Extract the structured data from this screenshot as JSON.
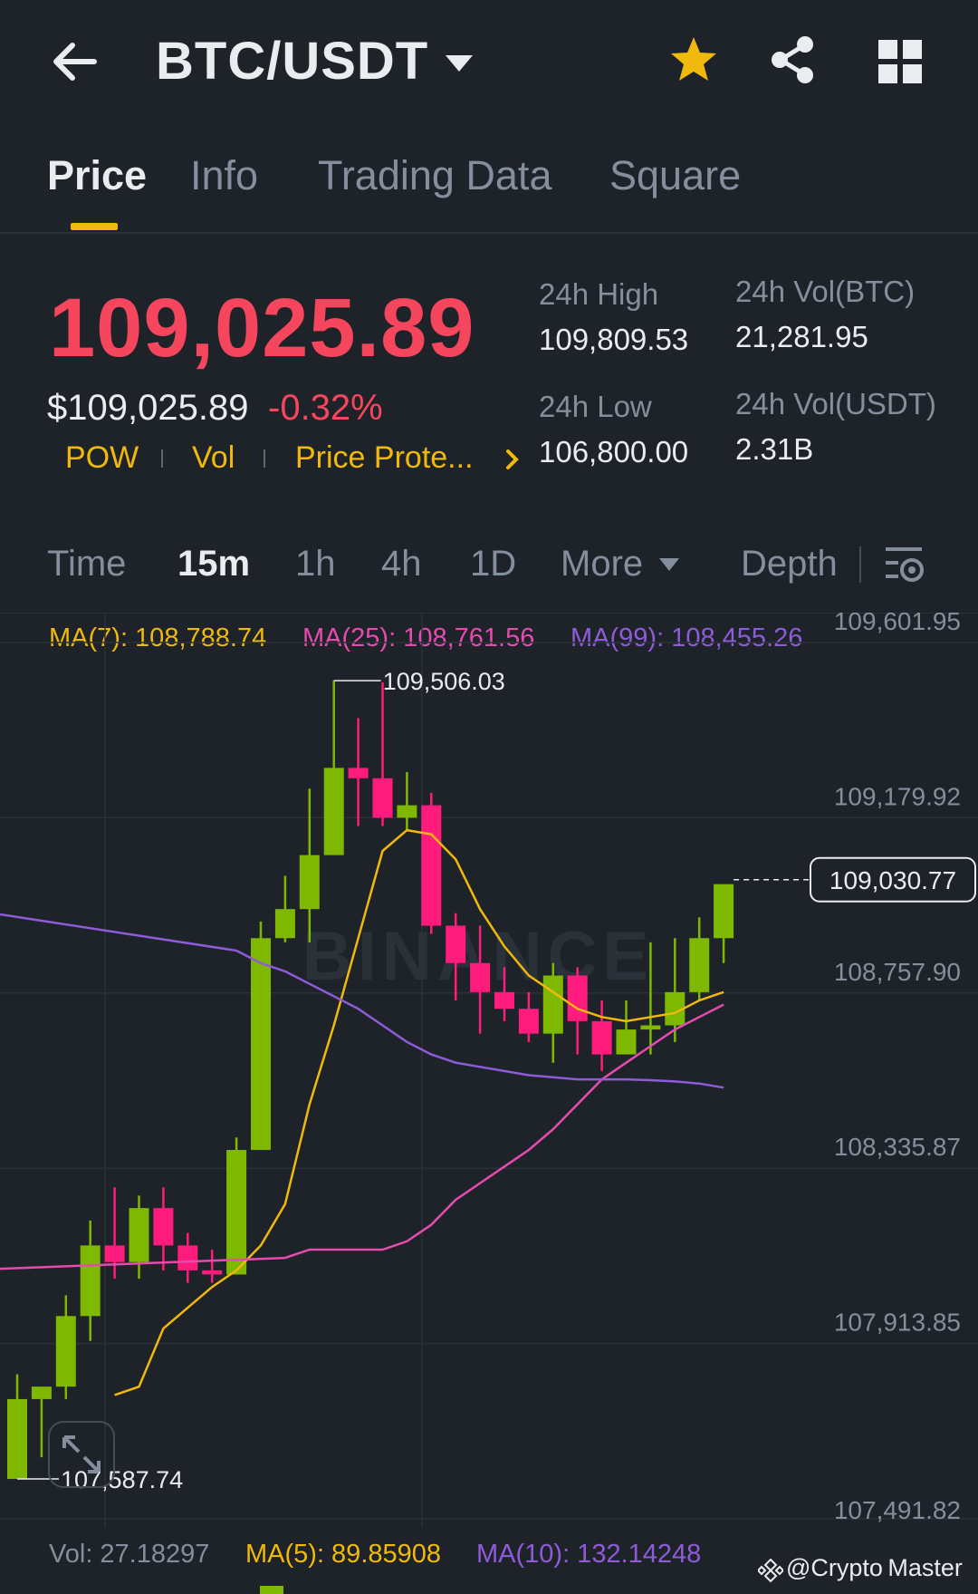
{
  "header": {
    "pair": "BTC/USDT",
    "icons": [
      "back-arrow-icon",
      "caret-down-icon",
      "star-icon",
      "share-icon",
      "grid-icon"
    ],
    "favorite_color": "#f0b90b"
  },
  "tabs": [
    {
      "label": "Price",
      "active": true
    },
    {
      "label": "Info",
      "active": false
    },
    {
      "label": "Trading Data",
      "active": false
    },
    {
      "label": "Square",
      "active": false
    }
  ],
  "ticker": {
    "last_price": "109,025.89",
    "usd_price": "$109,025.89",
    "change_pct": "-0.32%",
    "tags": [
      "POW",
      "Vol",
      "Price Prote..."
    ],
    "high_label": "24h High",
    "high_value": "109,809.53",
    "low_label": "24h Low",
    "low_value": "106,800.00",
    "vol_btc_label": "24h Vol(BTC)",
    "vol_btc_value": "21,281.95",
    "vol_usdt_label": "24h Vol(USDT)",
    "vol_usdt_value": "2.31B"
  },
  "intervals": {
    "items": [
      {
        "label": "Time",
        "active": false
      },
      {
        "label": "15m",
        "active": true
      },
      {
        "label": "1h",
        "active": false
      },
      {
        "label": "4h",
        "active": false
      },
      {
        "label": "1D",
        "active": false
      },
      {
        "label": "More",
        "active": false
      },
      {
        "label": "Depth",
        "active": false
      }
    ]
  },
  "ma_legend": {
    "ma7": "MA(7): 108,788.74",
    "ma25": "MA(25): 108,761.56",
    "ma99": "MA(99): 108,455.26"
  },
  "colors": {
    "up": "#7fb800",
    "down": "#ff1c7c",
    "ma7": "#f0b90b",
    "ma25": "#e64bb0",
    "ma99": "#8e5bd9",
    "bg": "#1e2329",
    "accent": "#f0b90b"
  },
  "chart_data": {
    "type": "candlestick",
    "interval": "15m",
    "y_ticks": [
      "109,601.95",
      "109,179.92",
      "108,757.90",
      "108,335.87",
      "107,913.85",
      "107,491.82"
    ],
    "y_tick_values": [
      109601.95,
      109179.92,
      108757.9,
      108335.87,
      107913.85,
      107491.82
    ],
    "ylim": [
      107491.82,
      109601.95
    ],
    "high_marker": "109,506.03",
    "low_marker": "107,587.74",
    "current_price_label": "109,030.77",
    "current_price": 109030.77,
    "candles": [
      {
        "o": 107587.74,
        "h": 107840,
        "l": 107587.74,
        "c": 107780
      },
      {
        "o": 107780,
        "h": 107780,
        "l": 107640,
        "c": 107810
      },
      {
        "o": 107810,
        "h": 108030,
        "l": 107780,
        "c": 107980
      },
      {
        "o": 107980,
        "h": 108210,
        "l": 107920,
        "c": 108150
      },
      {
        "o": 108150,
        "h": 108290,
        "l": 108070,
        "c": 108110
      },
      {
        "o": 108110,
        "h": 108270,
        "l": 108070,
        "c": 108240
      },
      {
        "o": 108240,
        "h": 108290,
        "l": 108090,
        "c": 108150
      },
      {
        "o": 108150,
        "h": 108180,
        "l": 108060,
        "c": 108090
      },
      {
        "o": 108090,
        "h": 108140,
        "l": 108060,
        "c": 108080
      },
      {
        "o": 108080,
        "h": 108410,
        "l": 108080,
        "c": 108380
      },
      {
        "o": 108380,
        "h": 108930,
        "l": 108380,
        "c": 108890
      },
      {
        "o": 108890,
        "h": 109040,
        "l": 108880,
        "c": 108960
      },
      {
        "o": 108960,
        "h": 109250,
        "l": 108880,
        "c": 109090
      },
      {
        "o": 109090,
        "h": 109510,
        "l": 109090,
        "c": 109300
      },
      {
        "o": 109300,
        "h": 109420,
        "l": 109160,
        "c": 109275
      },
      {
        "o": 109275,
        "h": 109506.03,
        "l": 109160,
        "c": 109180
      },
      {
        "o": 109180,
        "h": 109290,
        "l": 109150,
        "c": 109210
      },
      {
        "o": 109210,
        "h": 109240,
        "l": 108900,
        "c": 108920
      },
      {
        "o": 108920,
        "h": 108950,
        "l": 108740,
        "c": 108830
      },
      {
        "o": 108830,
        "h": 108920,
        "l": 108660,
        "c": 108760
      },
      {
        "o": 108760,
        "h": 108820,
        "l": 108690,
        "c": 108720
      },
      {
        "o": 108720,
        "h": 108760,
        "l": 108640,
        "c": 108660
      },
      {
        "o": 108660,
        "h": 108830,
        "l": 108590,
        "c": 108800
      },
      {
        "o": 108800,
        "h": 108820,
        "l": 108610,
        "c": 108690
      },
      {
        "o": 108690,
        "h": 108740,
        "l": 108570,
        "c": 108610
      },
      {
        "o": 108610,
        "h": 108740,
        "l": 108610,
        "c": 108670
      },
      {
        "o": 108670,
        "h": 108880,
        "l": 108610,
        "c": 108680
      },
      {
        "o": 108680,
        "h": 108890,
        "l": 108640,
        "c": 108760
      },
      {
        "o": 108760,
        "h": 108940,
        "l": 108740,
        "c": 108890
      },
      {
        "o": 108890,
        "h": 109020,
        "l": 108830,
        "c": 109020
      }
    ],
    "ma7": [
      107790,
      107810,
      107950,
      108000,
      108050,
      108090,
      108150,
      108250,
      108490,
      108680,
      108890,
      109100,
      109150,
      109140,
      109080,
      108960,
      108870,
      108800,
      108760,
      108720,
      108700,
      108690,
      108700,
      108710,
      108740,
      108760
    ],
    "ma25": [
      108120,
      108140,
      108140,
      108140,
      108140,
      108160,
      108200,
      108260,
      108300,
      108340,
      108380,
      108430,
      108490,
      108550,
      108590,
      108630,
      108670,
      108700,
      108730
    ],
    "ma99": [
      108860,
      108830,
      108810,
      108780,
      108750,
      108720,
      108680,
      108640,
      108610,
      108590,
      108580,
      108570,
      108560,
      108555,
      108550,
      108550,
      108550,
      108548,
      108545,
      108540,
      108530
    ]
  },
  "volume_legend": {
    "vol": "Vol: 27.18297",
    "ma5": "MA(5): 89.85908",
    "ma10": "MA(10): 132.14248"
  },
  "watermark": {
    "chart_brand": "BINANCE",
    "author": "@Crypto Master"
  }
}
